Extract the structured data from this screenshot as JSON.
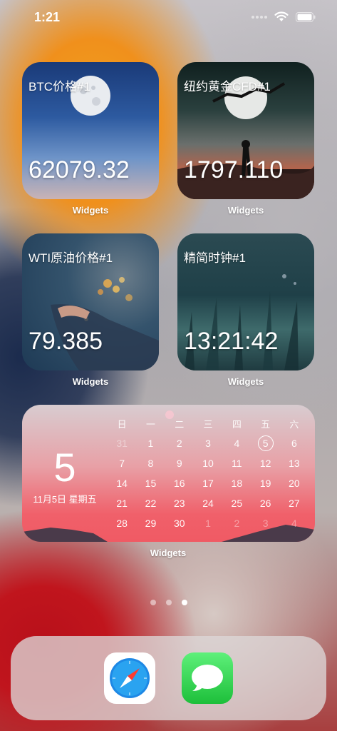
{
  "status_bar": {
    "time": "1:21"
  },
  "widgets": [
    {
      "title": "BTC价格#1",
      "value": "62079.32",
      "label": "Widgets"
    },
    {
      "title": "纽约黄金CFD#1",
      "value": "1797.110",
      "label": "Widgets"
    },
    {
      "title": "WTI原油价格#1",
      "value": "79.385",
      "label": "Widgets"
    },
    {
      "title": "精简时钟#1",
      "value": "13:21:42",
      "label": "Widgets"
    }
  ],
  "calendar": {
    "day": "5",
    "date_text": "11月5日  星期五",
    "label": "Widgets",
    "weekdays": [
      "日",
      "一",
      "二",
      "三",
      "四",
      "五",
      "六"
    ],
    "days": [
      [
        "31",
        "1",
        "2",
        "3",
        "4",
        "5",
        "6"
      ],
      [
        "7",
        "8",
        "9",
        "10",
        "11",
        "12",
        "13"
      ],
      [
        "14",
        "15",
        "16",
        "17",
        "18",
        "19",
        "20"
      ],
      [
        "21",
        "22",
        "23",
        "24",
        "25",
        "26",
        "27"
      ],
      [
        "28",
        "29",
        "30",
        "1",
        "2",
        "3",
        "4"
      ]
    ],
    "today": "5"
  },
  "page_dots": {
    "count": 3,
    "active_index": 2
  },
  "dock": {
    "apps": [
      "safari-icon",
      "messages-icon"
    ]
  },
  "colors": {
    "calendar_accent": "#f05a64",
    "messages_green": "#1dbf3a",
    "safari_blue": "#1e88e5"
  }
}
